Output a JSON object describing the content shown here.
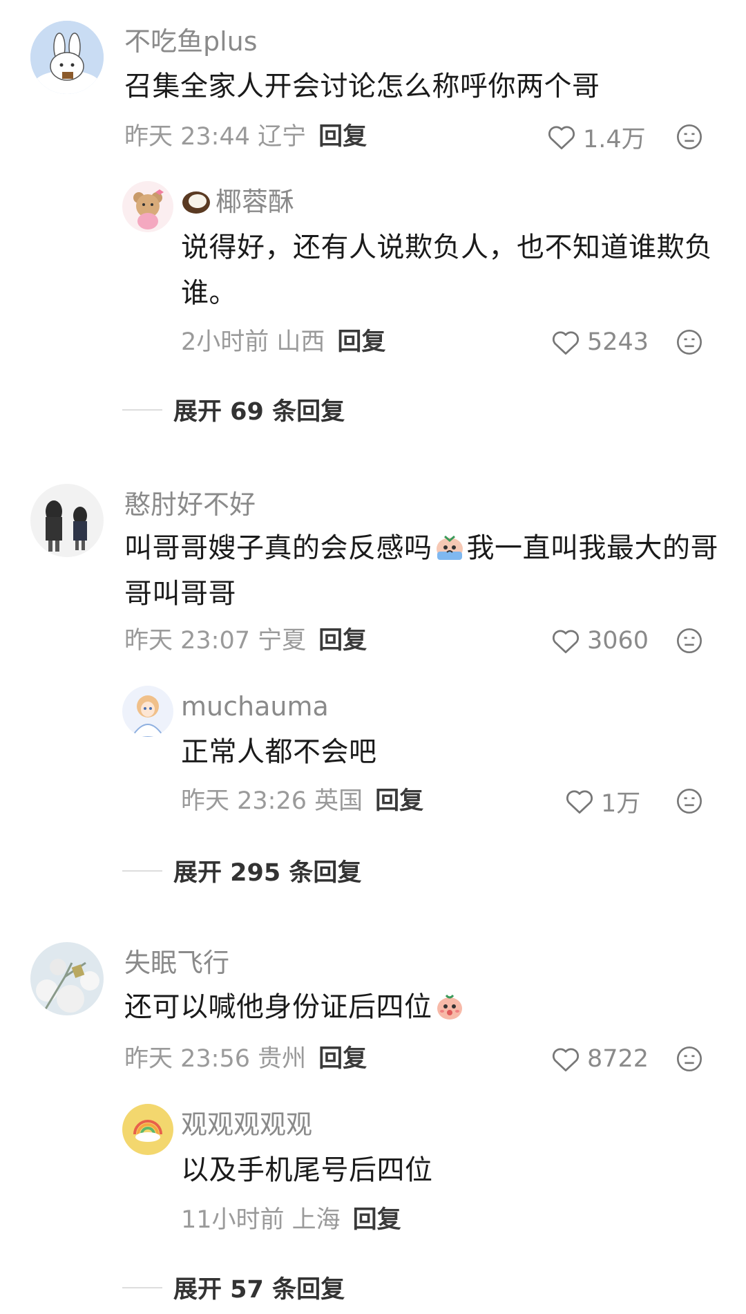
{
  "colors": {
    "text": "#1a1a1a",
    "meta": "#9a9a9a",
    "name": "#8a8a8a",
    "reply": "#3a3a3a"
  },
  "threads": [
    {
      "comment": {
        "name": "不吃鱼plus",
        "text": "召集全家人开会讨论怎么称呼你两个哥",
        "time": "昨天 23:44 辽宁",
        "reply_label": "回复",
        "likes": "1.4万"
      },
      "sub": {
        "name": "椰蓉酥",
        "text": "说得好，还有人说欺负人，也不知道谁欺负谁。",
        "time": "2小时前 山西",
        "reply_label": "回复",
        "likes": "5243"
      },
      "expand": "展开 69 条回复"
    },
    {
      "comment": {
        "name": "憨肘好不好",
        "text_before": "叫哥哥嫂子真的会反感吗",
        "emoji": "crying-emoji",
        "text_after": "我一直叫我最大的哥哥叫哥哥",
        "time": "昨天 23:07 宁夏",
        "reply_label": "回复",
        "likes": "3060"
      },
      "sub": {
        "name": "muchauma",
        "text": "正常人都不会吧",
        "time": "昨天 23:26 英国",
        "reply_label": "回复",
        "likes": "1万"
      },
      "expand": "展开 295 条回复"
    },
    {
      "comment": {
        "name": "失眠飞行",
        "text": "还可以喊他身份证后四位",
        "emoji": "peach-emoji",
        "time": "昨天 23:56 贵州",
        "reply_label": "回复",
        "likes": "8722"
      },
      "sub": {
        "name": "观观观观观",
        "text": "以及手机尾号后四位",
        "time": "11小时前 上海",
        "reply_label": "回复"
      },
      "expand": "展开 57 条回复"
    }
  ]
}
